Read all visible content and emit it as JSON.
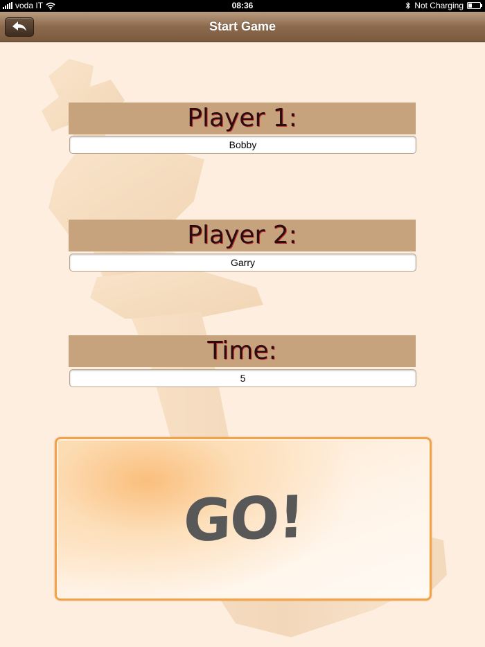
{
  "status_bar": {
    "carrier": "voda IT",
    "time": "08:36",
    "charging": "Not Charging"
  },
  "nav": {
    "title": "Start Game"
  },
  "form": {
    "player1": {
      "label": "Player 1:",
      "value": "Bobby"
    },
    "player2": {
      "label": "Player 2:",
      "value": "Garry"
    },
    "time": {
      "label": "Time:",
      "value": "5"
    }
  },
  "go_button": {
    "label": "GO!"
  },
  "colors": {
    "background": "#fdeee0",
    "header_band": "#c6a37d",
    "nav_bar": "#8c6a4d",
    "go_border": "#f0a34a",
    "go_text": "#585858"
  },
  "icons": {
    "back": "back-arrow-icon",
    "wifi": "wifi-icon",
    "bluetooth": "bluetooth-icon",
    "battery": "battery-icon",
    "signal": "signal-bars-icon"
  }
}
